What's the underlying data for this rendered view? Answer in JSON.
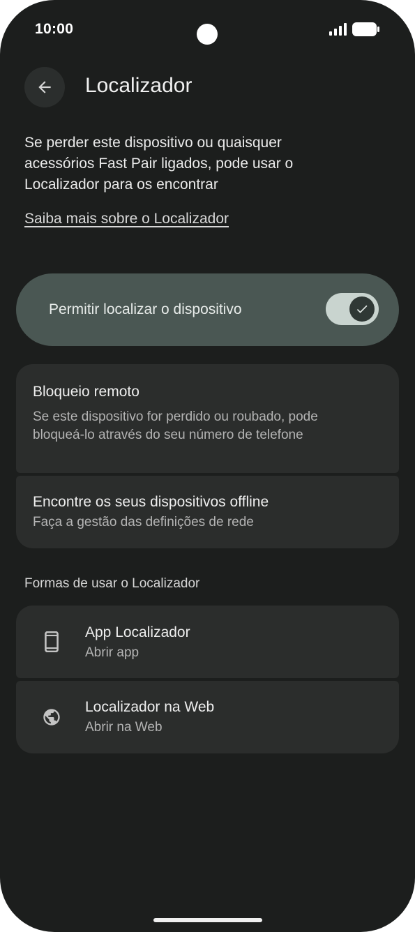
{
  "status_bar": {
    "time": "10:00",
    "signal_icon": "signal-bars-icon",
    "battery_icon": "battery-full-icon"
  },
  "header": {
    "back_icon": "arrow-back-icon",
    "title": "Localizador"
  },
  "intro": {
    "text": "Se perder este dispositivo ou quaisquer acessórios Fast Pair ligados, pode usar o Localizador para os encontrar",
    "learn_more_link": "Saiba mais sobre o Localizador"
  },
  "main_toggle": {
    "label": "Permitir localizar o dispositivo",
    "checked": true,
    "check_icon": "check-icon"
  },
  "settings": [
    {
      "title": "Bloqueio remoto",
      "subtitle": "Se este dispositivo for perdido ou roubado, pode bloqueá-lo através do seu número de telefone"
    },
    {
      "title": "Encontre os seus dispositivos offline",
      "subtitle": "Faça a gestão das definições de rede"
    }
  ],
  "ways_section": {
    "header": "Formas de usar o Localizador",
    "items": [
      {
        "icon": "phone-icon",
        "title": "App Localizador",
        "subtitle": "Abrir app"
      },
      {
        "icon": "globe-icon",
        "title": "Localizador na Web",
        "subtitle": "Abrir na Web"
      }
    ]
  },
  "colors": {
    "background": "#1c1e1d",
    "card": "#2b2d2c",
    "toggle_card": "#4a5753",
    "switch_track": "#c9d4cf"
  }
}
